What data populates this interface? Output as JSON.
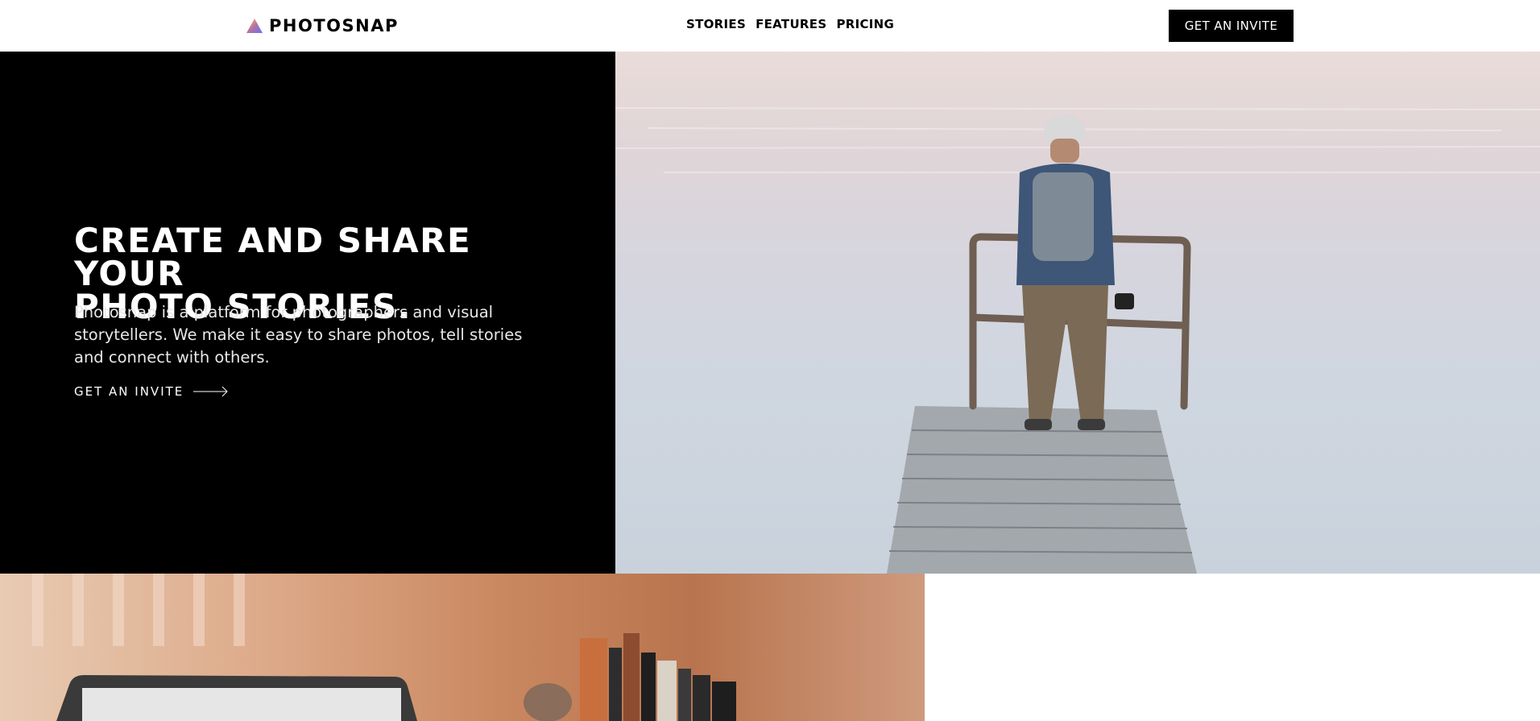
{
  "header": {
    "brand": "PHOTOSNAP",
    "nav": [
      {
        "label": "STORIES"
      },
      {
        "label": "FEATURES"
      },
      {
        "label": "PRICING"
      }
    ],
    "cta_label": "GET AN INVITE"
  },
  "hero": {
    "title_line1": "CREATE AND SHARE YOUR",
    "title_line2": "PHOTO STORIES.",
    "description": "Photosnap is a platform for photographers and visual storytellers. We make it easy to share photos, tell stories and connect with others.",
    "link_label": "GET AN INVITE",
    "image_alt_icon": "photo-man-on-dock"
  },
  "section2": {
    "image_icon": "photo-laptop-desk"
  },
  "colors": {
    "primary": "#000000",
    "background": "#ffffff",
    "logo_gradient": [
      "#ffc593",
      "#bc7198",
      "#5a77ff"
    ]
  }
}
